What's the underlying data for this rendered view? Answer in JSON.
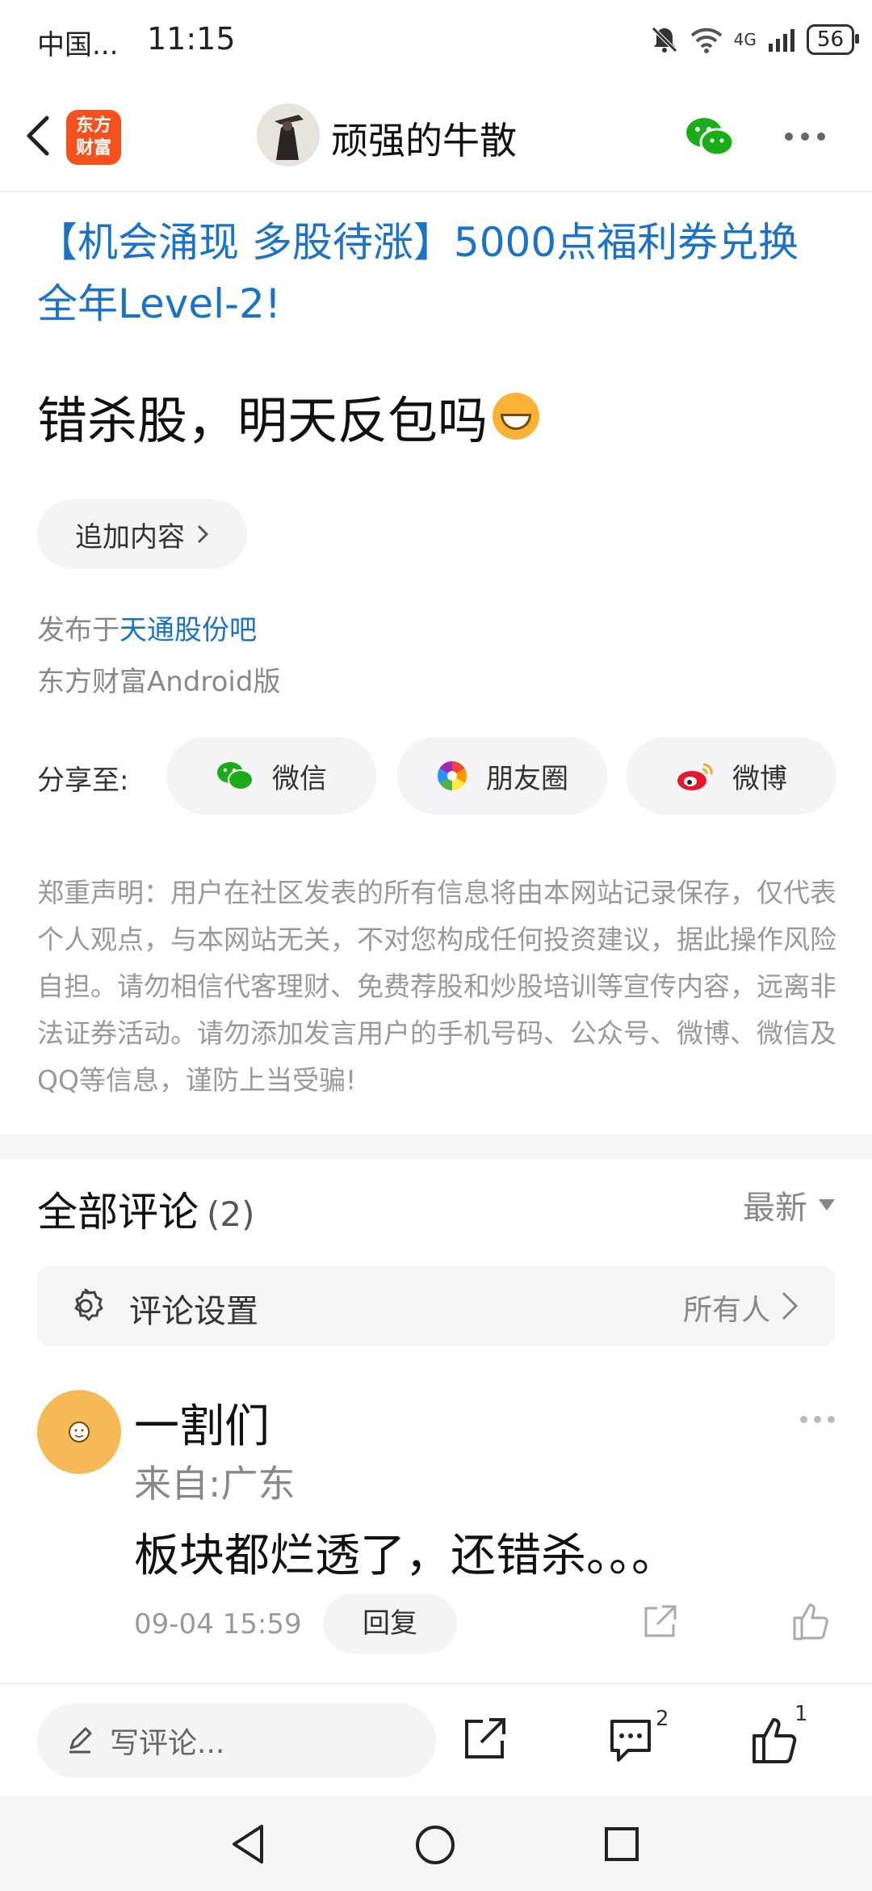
{
  "status_bar": {
    "carrier": "中国...",
    "time": "11:15",
    "network": "4G",
    "battery": "56"
  },
  "header": {
    "logo_line1": "东方",
    "logo_line2": "财富",
    "author": "顽强的牛散"
  },
  "post": {
    "promo": "【机会涌现 多股待涨】5000点福利券兑换全年Level-2!",
    "title": "错杀股，明天反包吗",
    "append_label": "追加内容",
    "published_prefix": "发布于",
    "forum": "天通股份吧",
    "client": "东方财富Android版"
  },
  "share": {
    "label": "分享至:",
    "wechat": "微信",
    "moments": "朋友圈",
    "weibo": "微博"
  },
  "disclaimer": "郑重声明：用户在社区发表的所有信息将由本网站记录保存，仅代表个人观点，与本网站无关，不对您构成任何投资建议，据此操作风险自担。请勿相信代客理财、免费荐股和炒股培训等宣传内容，远离非法证券活动。请勿添加发言用户的手机号码、公众号、微博、微信及QQ等信息，谨防上当受骗!",
  "comments": {
    "title": "全部评论",
    "count": "(2)",
    "sort": "最新",
    "settings_label": "评论设置",
    "settings_value": "所有人",
    "items": [
      {
        "name": "一割们",
        "location": "来自:广东",
        "text": "板块都烂透了，还错杀。。。",
        "time": "09-04 15:59",
        "reply": "回复"
      }
    ]
  },
  "bottom_bar": {
    "placeholder": "写评论...",
    "comment_count": "2",
    "like_count": "1"
  },
  "colors": {
    "link": "#1a73c8",
    "brand": "#f4511e",
    "wechat": "#1aad19"
  }
}
